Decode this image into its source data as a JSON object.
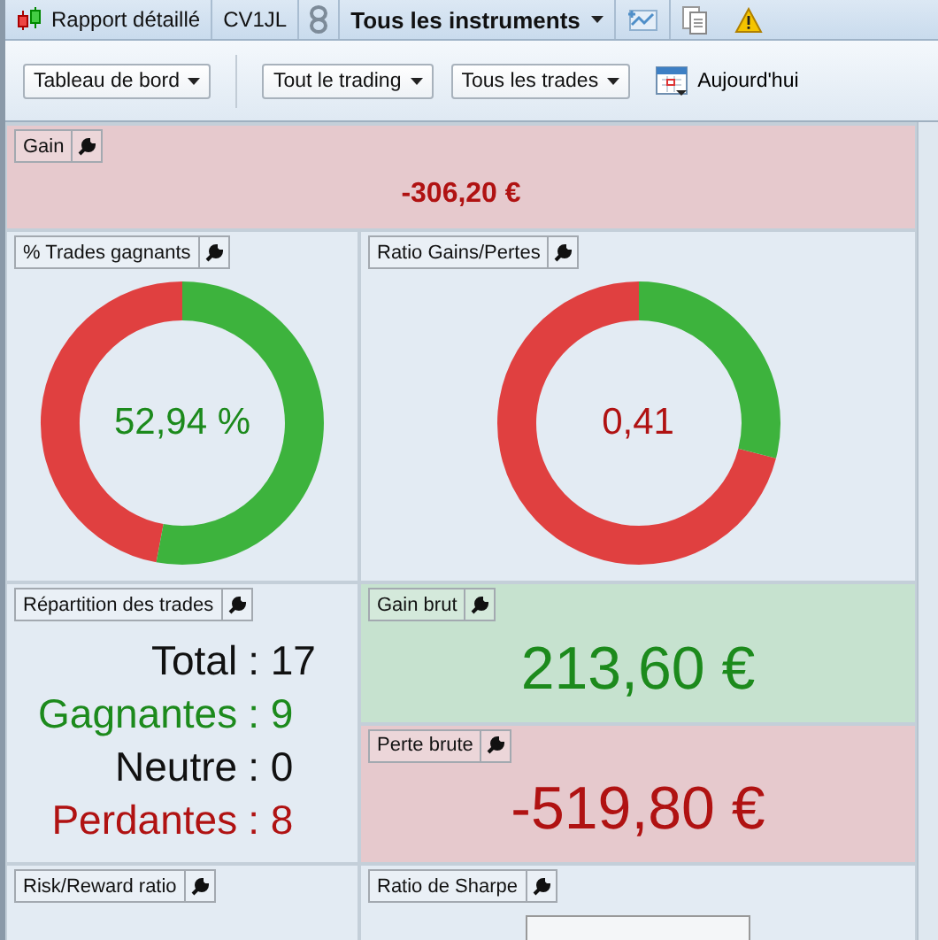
{
  "top_bar": {
    "report_tab": "Rapport détaillé",
    "account_tab": "CV1JL",
    "instrument_menu": "Tous les instruments"
  },
  "toolbar": {
    "dropdowns": [
      "Tableau de bord",
      "Tout le trading",
      "Tous les trades"
    ],
    "date": "Aujourd'hui"
  },
  "gain": {
    "title": "Gain",
    "value": "-306,20 €"
  },
  "win_rate": {
    "title": "% Trades gagnants",
    "value": "52,94 %"
  },
  "gain_loss_ratio": {
    "title": "Ratio Gains/Pertes",
    "value": "0,41"
  },
  "breakdown": {
    "title": "Répartition des trades",
    "lines": [
      {
        "label": "Total",
        "value": ": 17",
        "color": "#111111"
      },
      {
        "label": "Gagnantes",
        "value": ": 9",
        "color": "#1c8a1c"
      },
      {
        "label": "Neutre",
        "value": ": 0",
        "color": "#111111"
      },
      {
        "label": "Perdantes",
        "value": ": 8",
        "color": "#b01212"
      }
    ]
  },
  "gross_gain": {
    "title": "Gain brut",
    "value": "213,60 €"
  },
  "gross_loss": {
    "title": "Perte brute",
    "value": "-519,80 €"
  },
  "risk_reward": {
    "title": "Risk/Reward ratio"
  },
  "sharpe": {
    "title": "Ratio de Sharpe"
  }
}
